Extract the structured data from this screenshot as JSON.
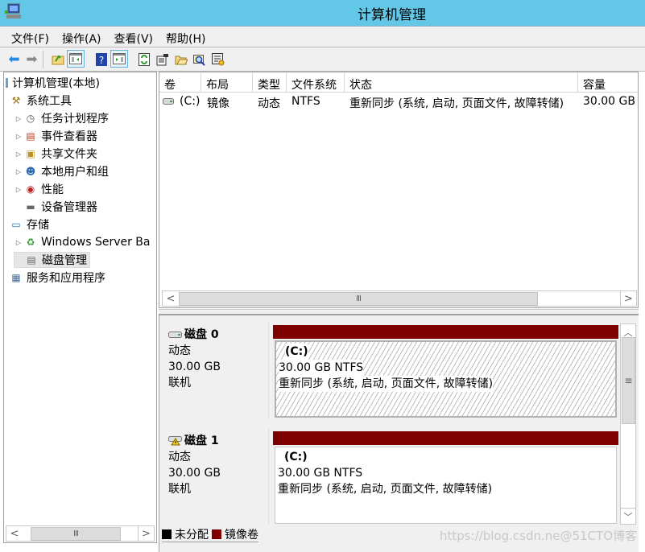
{
  "window": {
    "title": "计算机管理",
    "icon": "computer-management-icon"
  },
  "menu": [
    {
      "label": "文件(F)"
    },
    {
      "label": "操作(A)"
    },
    {
      "label": "查看(V)"
    },
    {
      "label": "帮助(H)"
    }
  ],
  "toolbar": [
    {
      "name": "back-icon",
      "glyph": "⇦"
    },
    {
      "name": "forward-icon",
      "glyph": "⇨"
    },
    {
      "name": "up-folder-icon",
      "glyph": "📂"
    },
    {
      "name": "show-hide-tree-icon",
      "glyph": "▤"
    },
    {
      "name": "help-icon",
      "glyph": "?"
    },
    {
      "name": "show-hide-action-pane-icon",
      "glyph": "▥"
    },
    {
      "name": "refresh-icon",
      "glyph": "⟳"
    },
    {
      "name": "properties-icon",
      "glyph": "🗎"
    },
    {
      "name": "open-icon",
      "glyph": "📁"
    },
    {
      "name": "search-icon",
      "glyph": "🔍"
    },
    {
      "name": "settings-icon",
      "glyph": "⚙"
    }
  ],
  "tree": [
    {
      "label": "计算机管理(本地)",
      "icon": "computer-icon",
      "level": 0,
      "expander": ""
    },
    {
      "label": "系统工具",
      "icon": "tools-icon",
      "level": 1,
      "expander": ""
    },
    {
      "label": "任务计划程序",
      "icon": "clock-icon",
      "level": 2,
      "expander": "▷"
    },
    {
      "label": "事件查看器",
      "icon": "event-log-icon",
      "level": 2,
      "expander": "▷"
    },
    {
      "label": "共享文件夹",
      "icon": "shared-folder-icon",
      "level": 2,
      "expander": "▷"
    },
    {
      "label": "本地用户和组",
      "icon": "users-icon",
      "level": 2,
      "expander": "▷"
    },
    {
      "label": "性能",
      "icon": "performance-icon",
      "level": 2,
      "expander": "▷"
    },
    {
      "label": "设备管理器",
      "icon": "device-manager-icon",
      "level": 2,
      "expander": ""
    },
    {
      "label": "存储",
      "icon": "storage-icon",
      "level": 1,
      "expander": ""
    },
    {
      "label": "Windows Server Ba",
      "icon": "backup-icon",
      "level": 2,
      "expander": "▷"
    },
    {
      "label": "磁盘管理",
      "icon": "disk-management-icon",
      "level": 2,
      "expander": "",
      "selected": true
    },
    {
      "label": "服务和应用程序",
      "icon": "services-icon",
      "level": 1,
      "expander": ""
    }
  ],
  "volume_list": {
    "columns": [
      "卷",
      "布局",
      "类型",
      "文件系统",
      "状态",
      "容量"
    ],
    "rows": [
      {
        "volume": "(C:)",
        "layout": "镜像",
        "type": "动态",
        "fs": "NTFS",
        "status": "重新同步 (系统, 启动, 页面文件, 故障转储)",
        "capacity": "30.00 GB"
      }
    ]
  },
  "disks": [
    {
      "name": "磁盘 0",
      "type": "动态",
      "size": "30.00 GB",
      "state": "联机",
      "warning": false,
      "volume": {
        "label": "(C:)",
        "size_fs": "30.00 GB NTFS",
        "status": "重新同步 (系统, 启动, 页面文件, 故障转储)",
        "selected": true
      }
    },
    {
      "name": "磁盘 1",
      "type": "动态",
      "size": "30.00 GB",
      "state": "联机",
      "warning": true,
      "volume": {
        "label": "(C:)",
        "size_fs": "30.00 GB NTFS",
        "status": "重新同步 (系统, 启动, 页面文件, 故障转储)",
        "selected": false
      }
    }
  ],
  "legend": [
    {
      "label": "未分配",
      "color": "#000000"
    },
    {
      "label": "镜像卷",
      "color": "#7f0000"
    }
  ],
  "colors": {
    "titlebar": "#63c7e8",
    "mirror_volume": "#7f0000"
  },
  "scroll": {
    "grip": "III",
    "vgrip": "≡",
    "left": "<",
    "right": ">",
    "up": "^",
    "down": "v"
  },
  "watermark": "https://blog.csdn.ne@51CTO博客"
}
